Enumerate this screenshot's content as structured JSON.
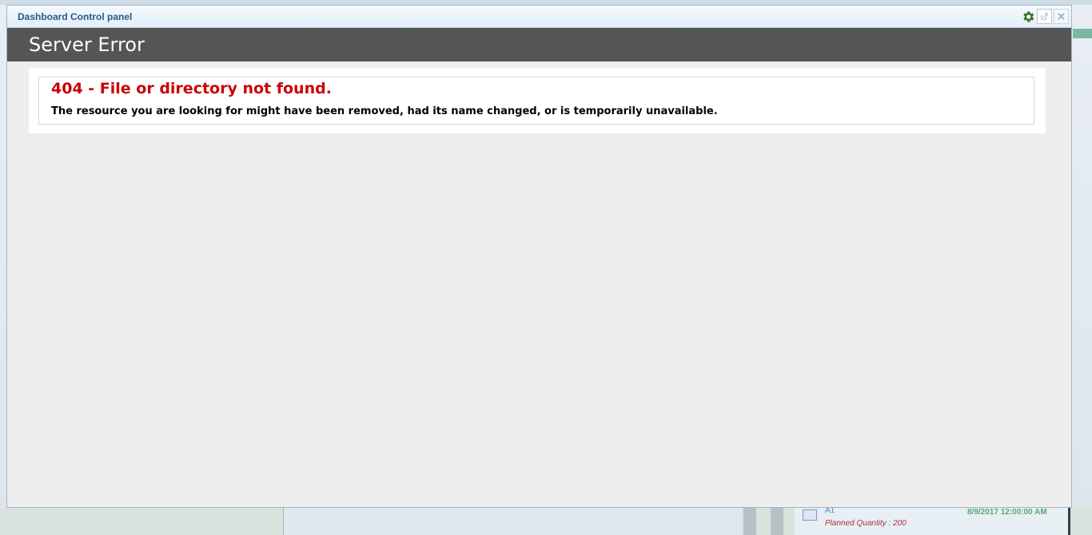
{
  "window": {
    "title": "Dashboard Control panel"
  },
  "error_page": {
    "header": "Server Error",
    "heading": "404 - File or directory not found.",
    "message": "The resource you are looking for might have been removed, had its name changed, or is temporarily unavailable."
  },
  "background": {
    "planned_quantity": "Planned Quantity : 200",
    "date_fragment": "8/9/2017 12:00:00 AM",
    "name_fragment": "A1"
  },
  "colors": {
    "header_bg": "#555555",
    "error_red": "#cc0000",
    "title_blue": "#2b5a86",
    "gear_green": "#3a6e2a"
  },
  "icons": {
    "settings": "gear-icon",
    "popout": "popout-icon",
    "close": "close-icon"
  }
}
